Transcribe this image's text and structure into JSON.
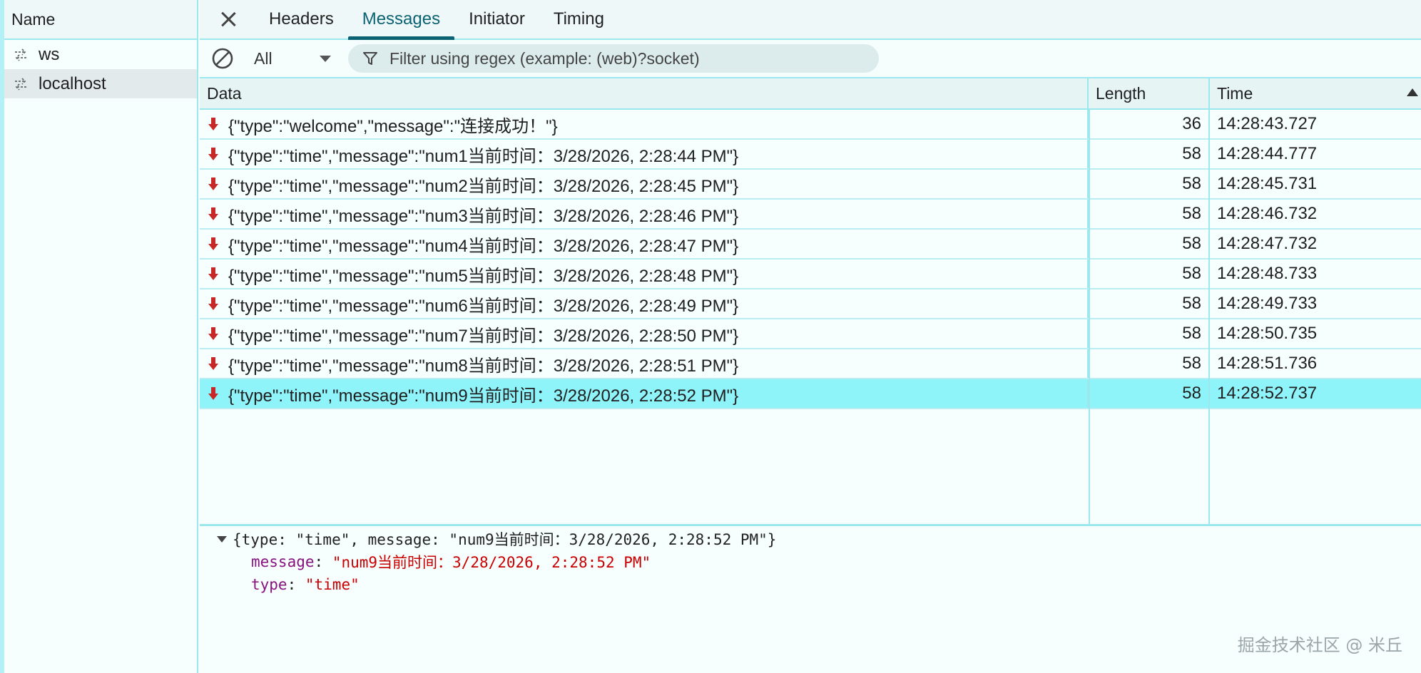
{
  "left_panel": {
    "header": "Name",
    "requests": [
      {
        "label": "ws",
        "selected": false
      },
      {
        "label": "localhost",
        "selected": true
      }
    ]
  },
  "tabs": [
    {
      "label": "Headers",
      "active": false
    },
    {
      "label": "Messages",
      "active": true
    },
    {
      "label": "Initiator",
      "active": false
    },
    {
      "label": "Timing",
      "active": false
    }
  ],
  "toolbar": {
    "filter_type": "All",
    "filter_placeholder": "Filter using regex (example: (web)?socket)"
  },
  "grid": {
    "columns": {
      "data": "Data",
      "length": "Length",
      "time": "Time"
    },
    "sort": "Time ascending",
    "rows": [
      {
        "data": "{\"type\":\"welcome\",\"message\":\"连接成功！\"}",
        "length": "36",
        "time": "14:28:43.727"
      },
      {
        "data": "{\"type\":\"time\",\"message\":\"num1当前时间：3/28/2026, 2:28:44 PM\"}",
        "length": "58",
        "time": "14:28:44.777"
      },
      {
        "data": "{\"type\":\"time\",\"message\":\"num2当前时间：3/28/2026, 2:28:45 PM\"}",
        "length": "58",
        "time": "14:28:45.731"
      },
      {
        "data": "{\"type\":\"time\",\"message\":\"num3当前时间：3/28/2026, 2:28:46 PM\"}",
        "length": "58",
        "time": "14:28:46.732"
      },
      {
        "data": "{\"type\":\"time\",\"message\":\"num4当前时间：3/28/2026, 2:28:47 PM\"}",
        "length": "58",
        "time": "14:28:47.732"
      },
      {
        "data": "{\"type\":\"time\",\"message\":\"num5当前时间：3/28/2026, 2:28:48 PM\"}",
        "length": "58",
        "time": "14:28:48.733"
      },
      {
        "data": "{\"type\":\"time\",\"message\":\"num6当前时间：3/28/2026, 2:28:49 PM\"}",
        "length": "58",
        "time": "14:28:49.733"
      },
      {
        "data": "{\"type\":\"time\",\"message\":\"num7当前时间：3/28/2026, 2:28:50 PM\"}",
        "length": "58",
        "time": "14:28:50.735"
      },
      {
        "data": "{\"type\":\"time\",\"message\":\"num8当前时间：3/28/2026, 2:28:51 PM\"}",
        "length": "58",
        "time": "14:28:51.736"
      },
      {
        "data": "{\"type\":\"time\",\"message\":\"num9当前时间：3/28/2026, 2:28:52 PM\"}",
        "length": "58",
        "time": "14:28:52.737",
        "selected": true
      }
    ]
  },
  "detail": {
    "summary": "{type: \"time\", message: \"num9当前时间：3/28/2026, 2:28:52 PM\"}",
    "properties": [
      {
        "key": "message",
        "value": "\"num9当前时间：3/28/2026, 2:28:52 PM\""
      },
      {
        "key": "type",
        "value": "\"time\""
      }
    ]
  },
  "watermark": "掘金技术社区 @ 米丘",
  "colors": {
    "accent": "#0b6272",
    "selected_row": "#8ff3fa",
    "border": "#9ce8ef",
    "incoming_arrow": "#c62828"
  }
}
